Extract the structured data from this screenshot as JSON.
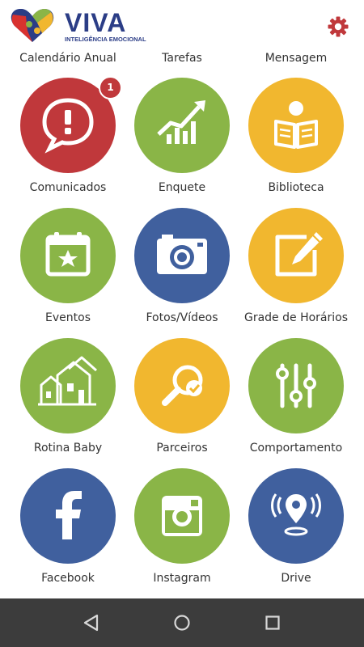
{
  "app": {
    "logo_title": "VIVA",
    "logo_subtitle": "INTELIGÊNCIA EMOCIONAL",
    "icon": "gear-icon"
  },
  "top_row": [
    "Calendário Anual",
    "Tarefas",
    "Mensagem"
  ],
  "tiles": [
    {
      "label": "Comunicados",
      "icon": "speech-exclamation-icon",
      "color": "#c0383b",
      "badge": "1"
    },
    {
      "label": "Enquete",
      "icon": "chart-trend-icon",
      "color": "#8ab547"
    },
    {
      "label": "Biblioteca",
      "icon": "reading-person-icon",
      "color": "#f1b72f"
    },
    {
      "label": "Eventos",
      "icon": "calendar-star-icon",
      "color": "#8ab547"
    },
    {
      "label": "Fotos/Vídeos",
      "icon": "camera-icon",
      "color": "#40609e"
    },
    {
      "label": "Grade de Horários",
      "icon": "pencil-square-icon",
      "color": "#f1b72f"
    },
    {
      "label": "Rotina Baby",
      "icon": "houses-icon",
      "color": "#8ab547"
    },
    {
      "label": "Parceiros",
      "icon": "magnifier-check-icon",
      "color": "#f1b72f"
    },
    {
      "label": "Comportamento",
      "icon": "sliders-icon",
      "color": "#8ab547"
    },
    {
      "label": "Facebook",
      "icon": "facebook-icon",
      "color": "#40609e"
    },
    {
      "label": "Instagram",
      "icon": "instagram-icon",
      "color": "#8ab547"
    },
    {
      "label": "Drive",
      "icon": "location-broadcast-icon",
      "color": "#40609e"
    }
  ],
  "navbar": {
    "color": "#3c3c3c",
    "buttons": [
      "back-icon",
      "home-icon",
      "recents-icon"
    ]
  }
}
